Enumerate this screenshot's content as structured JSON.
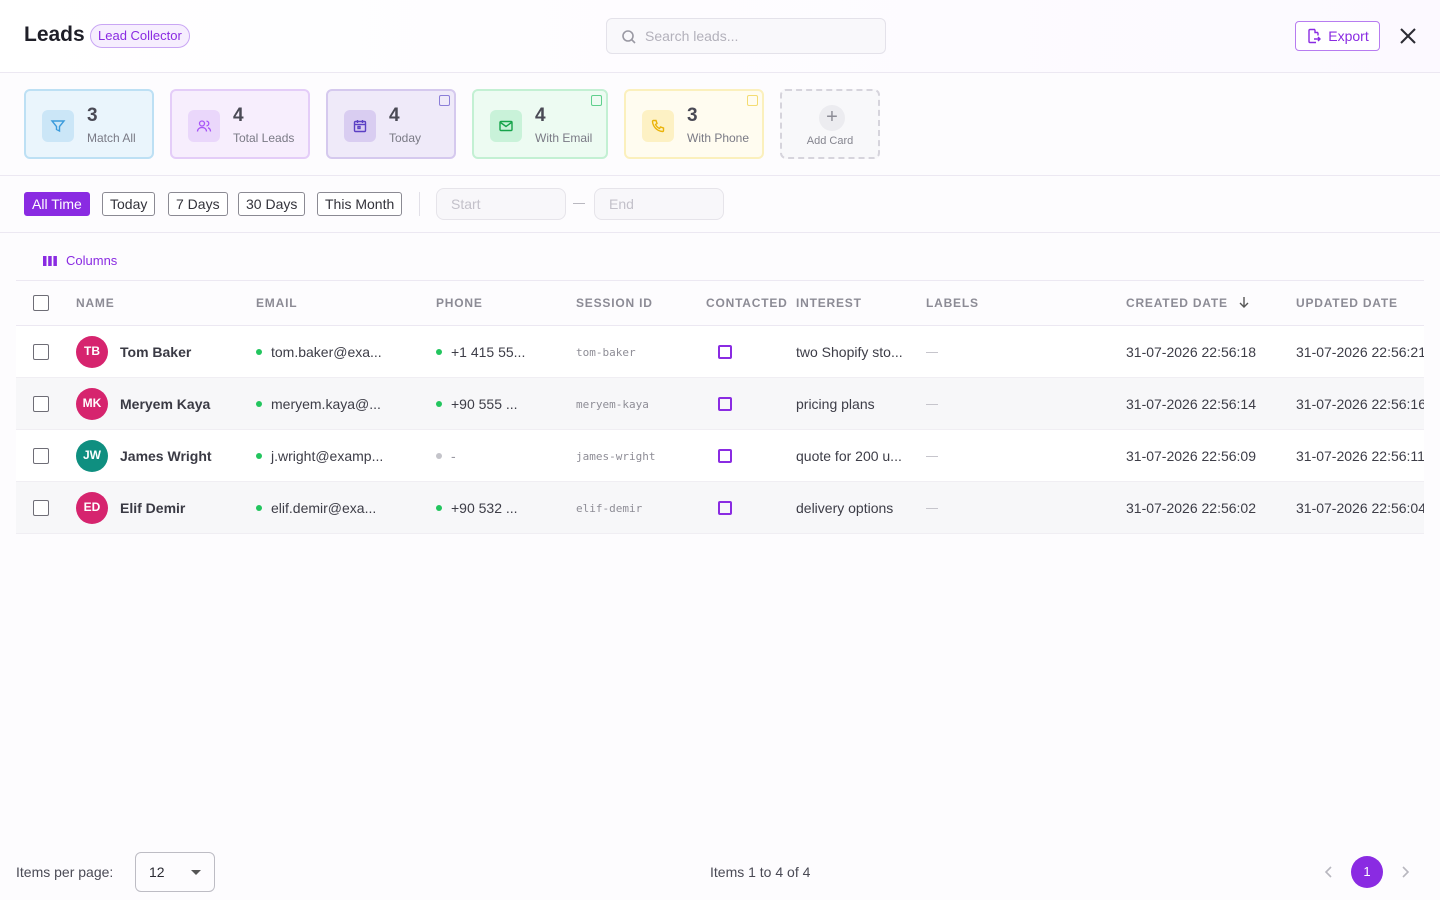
{
  "header": {
    "title": "Leads",
    "badge": "Lead Collector",
    "search_placeholder": "Search leads...",
    "export_label": "Export"
  },
  "cards": [
    {
      "value": "3",
      "label": "Match All",
      "icon": "filter-icon",
      "color": "#3b9bdc"
    },
    {
      "value": "4",
      "label": "Total Leads",
      "icon": "users-icon",
      "color": "#a855f7"
    },
    {
      "value": "4",
      "label": "Today",
      "icon": "calendar-icon",
      "color": "#5b3fc4"
    },
    {
      "value": "4",
      "label": "With Email",
      "icon": "mail-icon",
      "color": "#22c55e"
    },
    {
      "value": "3",
      "label": "With Phone",
      "icon": "phone-icon",
      "color": "#eab308"
    }
  ],
  "add_card_label": "Add Card",
  "filters": {
    "chips": [
      "All Time",
      "Today",
      "7 Days",
      "30 Days",
      "This Month"
    ],
    "active": "All Time",
    "start_placeholder": "Start",
    "end_placeholder": "End"
  },
  "columns_label": "Columns",
  "table": {
    "headers": {
      "name": "NAME",
      "email": "EMAIL",
      "phone": "PHONE",
      "session": "SESSION ID",
      "contacted": "CONTACTED",
      "interest": "INTEREST",
      "labels": "LABELS",
      "created": "CREATED DATE",
      "updated": "UPDATED DATE"
    },
    "rows": [
      {
        "initials": "TB",
        "avatar_color": "#d6246e",
        "name": "Tom Baker",
        "email": "tom.baker@exa...",
        "phone": "+1 415 55...",
        "phone_dot": "#22c55e",
        "session": "tom-baker",
        "interest": "two Shopify sto...",
        "created": "31-07-2026 22:56:18",
        "updated": "31-07-2026 22:56:21"
      },
      {
        "initials": "MK",
        "avatar_color": "#d6246e",
        "name": "Meryem Kaya",
        "email": "meryem.kaya@...",
        "phone": "+90 555 ...",
        "phone_dot": "#22c55e",
        "session": "meryem-kaya",
        "interest": "pricing plans",
        "created": "31-07-2026 22:56:14",
        "updated": "31-07-2026 22:56:16"
      },
      {
        "initials": "JW",
        "avatar_color": "#0f8f80",
        "name": "James Wright",
        "email": "j.wright@examp...",
        "phone": "-",
        "phone_dot": "#c4c4ca",
        "session": "james-wright",
        "interest": "quote for 200 u...",
        "created": "31-07-2026 22:56:09",
        "updated": "31-07-2026 22:56:11"
      },
      {
        "initials": "ED",
        "avatar_color": "#d6246e",
        "name": "Elif Demir",
        "email": "elif.demir@exa...",
        "phone": "+90 532 ...",
        "phone_dot": "#22c55e",
        "session": "elif-demir",
        "interest": "delivery options",
        "created": "31-07-2026 22:56:02",
        "updated": "31-07-2026 22:56:04"
      }
    ]
  },
  "footer": {
    "per_page_label": "Items per page:",
    "per_page_value": "12",
    "items_info": "Items 1 to 4 of 4",
    "current_page": "1"
  }
}
